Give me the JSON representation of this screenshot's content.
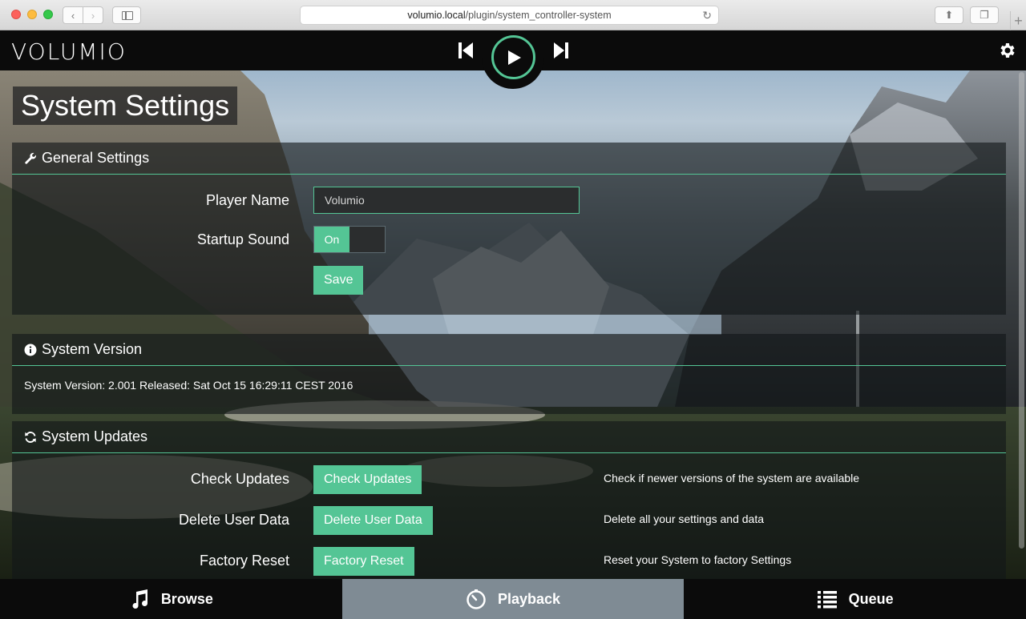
{
  "browser": {
    "url_host": "volumio.local",
    "url_path": "/plugin/system_controller-system"
  },
  "header": {
    "logo": "VOLUMIO"
  },
  "page": {
    "title": "System Settings"
  },
  "general": {
    "title": "General Settings",
    "player_name_label": "Player Name",
    "player_name_value": "Volumio",
    "startup_sound_label": "Startup Sound",
    "startup_sound_state": "On",
    "save_label": "Save"
  },
  "version": {
    "title": "System Version",
    "text": "System Version: 2.001 Released: Sat Oct 15 16:29:11 CEST 2016"
  },
  "updates": {
    "title": "System Updates",
    "rows": [
      {
        "label": "Check Updates",
        "button": "Check Updates",
        "desc": "Check if newer versions of the system are available"
      },
      {
        "label": "Delete User Data",
        "button": "Delete User Data",
        "desc": "Delete all your settings and data"
      },
      {
        "label": "Factory Reset",
        "button": "Factory Reset",
        "desc": "Reset your System to factory Settings"
      }
    ]
  },
  "footer": {
    "browse": "Browse",
    "playback": "Playback",
    "queue": "Queue"
  },
  "colors": {
    "accent": "#54c595",
    "active_tab": "#7f8b94"
  }
}
